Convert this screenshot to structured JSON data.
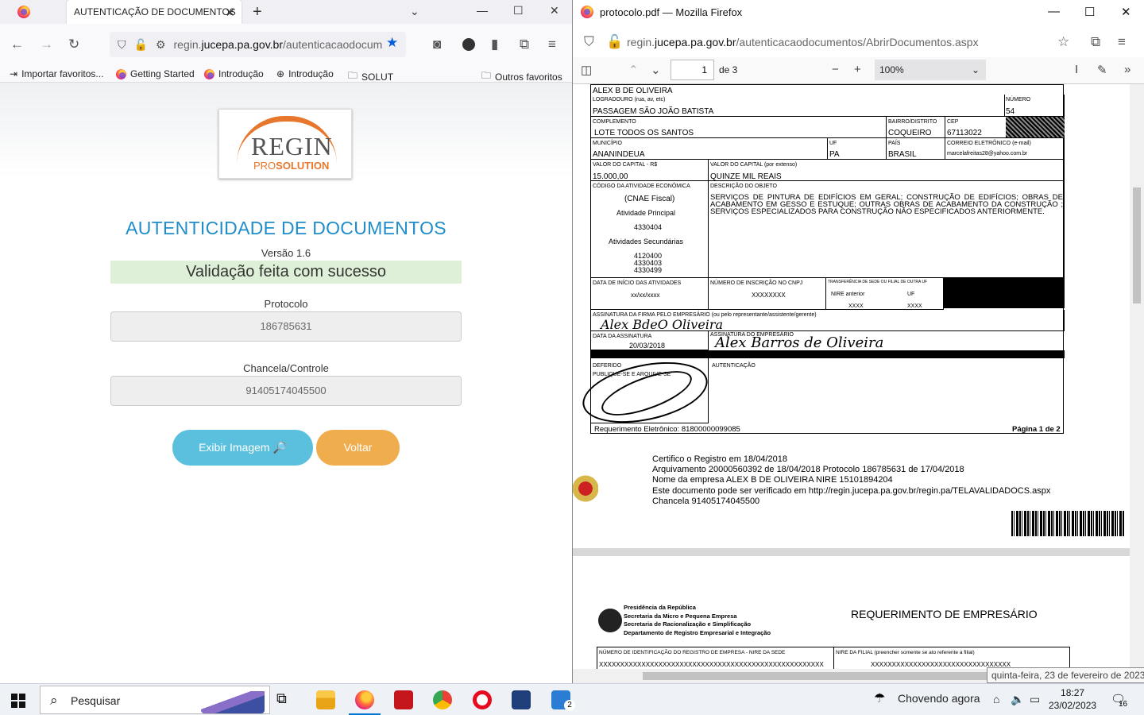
{
  "left": {
    "tab_title": "AUTENTICAÇÃO DE DOCUMENTOS",
    "tab_close": "✕",
    "new_tab": "+",
    "url_host": "regin.",
    "url_bold": "jucepa.pa.gov.br",
    "url_rest": "/autenticacaodocum",
    "bookmarks": [
      "Importar favoritos...",
      "Getting Started",
      "Introdução",
      "Introdução",
      "SOLUT",
      "Outros favoritos"
    ],
    "logo_word": "REGIN",
    "logo_pro": "PRO",
    "logo_solution": "SOLUTION",
    "page_title": "AUTENTICIDADE DE DOCUMENTOS",
    "version": "Versão 1.6",
    "success": "Validação feita com sucesso",
    "protocolo_label": "Protocolo",
    "protocolo_value": "186785631",
    "chancela_label": "Chancela/Controle",
    "chancela_value": "91405174045500",
    "btn_show": "Exibir Imagem 🔎",
    "btn_back": "Voltar"
  },
  "right": {
    "window_title": "protocolo.pdf — Mozilla Firefox",
    "url_host": "regin.",
    "url_bold": "jucepa.pa.gov.br",
    "url_rest": "/autenticacaodocumentos/AbrirDocumentos.aspx",
    "page_number": "1",
    "page_of": "de 3",
    "zoom": "100%",
    "form": {
      "name": "ALEX B DE OLIVEIRA",
      "logradouro_label": "LOGRADOURO (rua, av, etc)",
      "logradouro": "PASSAGEM SÃO JOÃO BATISTA",
      "numero_label": "NÚMERO",
      "numero": "54",
      "complemento_label": "COMPLEMENTO",
      "complemento": "LOTE TODOS OS SANTOS",
      "bairro_label": "BAIRRO/DISTRITO",
      "bairro": "COQUEIRO",
      "cep_label": "CEP",
      "cep": "67113022",
      "municipio_label": "MUNICÍPIO",
      "municipio": "ANANINDEUA",
      "uf_label": "UF",
      "uf": "PA",
      "pais_label": "PAÍS",
      "pais": "BRASIL",
      "email_label": "CORREIO ELETRÔNICO (e-mail)",
      "email": "marcelafreitas28@yahoo.com.br",
      "capital_label": "VALOR DO CAPITAL - R$",
      "capital": "15.000,00",
      "capital_ext_label": "VALOR DO CAPITAL (por extenso)",
      "capital_ext": "QUINZE  MIL  REAIS",
      "cnae_label": "CÓDIGO DA ATIVIDADE ECONÔMICA",
      "cnae": "(CNAE Fiscal)",
      "ativ_principal_label": "Atividade Principal",
      "ativ_principal": "4330404",
      "ativ_sec_label": "Atividades Secundárias",
      "ativ_sec": [
        "4120400",
        "4330403",
        "4330499"
      ],
      "objeto_label": "DESCRIÇÃO DO OBJETO",
      "objeto": "SERVIÇOS DE PINTURA DE EDIFÍCIOS EM GERAL; CONSTRUÇÃO DE EDIFÍCIOS; OBRAS DE ACABAMENTO EM GESSO E ESTUQUE; OUTRAS OBRAS DE ACABAMENTO DA CONSTRUÇÃO ; SERVIÇOS ESPECIALIZADOS PARA CONSTRUÇÃO NÃO ESPECIFICADOS ANTERIORMENTE.",
      "inicio_label": "DATA DE INÍCIO DAS ATIVIDADES",
      "inicio": "xx/xx/xxxx",
      "cnpj_label": "NÚMERO DE INSCRIÇÃO NO CNPJ",
      "cnpj": "XXXXXXXX",
      "transf_label": "TRANSFERÊNCIA DE SEDE OU FILIAL DE OUTRA UF",
      "nire_ant_label": "NIRE anterior",
      "uf2_label": "UF",
      "nire_ant": "XXXX",
      "uf2": "XXXX",
      "assin_firma_label": "ASSINATURA DA FIRMA PELO EMPRESÁRIO (ou pelo representante/assistente/gerente)",
      "sig1": "Alex BdeO Oliveira",
      "data_assin_label": "DATA DA ASSINATURA",
      "data_assin": "20/03/2018",
      "assin_emp_label": "ASSINATURA DO EMPRESÁRIO",
      "sig2": "Alex Barros de Oliveira",
      "deferido_label": "DEFERIDO",
      "publique_label": "PUBLIQUE-SE E ARQUIVE-SE",
      "autenticacao_label": "AUTENTICAÇÃO",
      "req_eletronico": "Requerimento Eletrônico: 81800000099085",
      "pagina": "Página 1 de 2"
    },
    "cert_lines": [
      "Certifico o Registro em 18/04/2018",
      "Arquivamento 20000560392 de 18/04/2018 Protocolo 186785631 de 17/04/2018",
      "Nome da empresa ALEX B DE OLIVEIRA NIRE 15101894204",
      "Este documento pode ser verificado em http://regin.jucepa.pa.gov.br/regin.pa/TELAVALIDADOCS.aspx",
      "Chancela 91405174045500"
    ],
    "gov_lines": [
      "Presidência da República",
      "Secretaria da Micro e Pequena Empresa",
      "Secretaria de Racionalização e Simplificação",
      "Departamento de Registro Empresarial e Integração"
    ],
    "req_title": "REQUERIMENTO DE EMPRESÁRIO",
    "nire_sede_label": "NÚMERO DE IDENTIFICAÇÃO DO REGISTRO DE EMPRESA - NIRE DA SEDE",
    "nire_filial_label": "NIRE DA FILIAL (preencher somente se ato referente a filial)",
    "nire_sede": "XXXXXXXXXXXXXXXXXXXXXXXXXXXXXXXXXXXXXXXXXXXXXXXXXXXXX",
    "nire_filial": "XXXXXXXXXXXXXXXXXXXXXXXXXXXXXXXXX",
    "tooltip": "quinta-feira, 23 de fevereiro de 2023"
  },
  "taskbar": {
    "search": "Pesquisar",
    "weather": "Chovendo agora",
    "time": "18:27",
    "date": "23/02/2023",
    "notif_count": "16",
    "mail_badge": "2"
  },
  "colors": {
    "title_blue": "#1f8dc9",
    "success_bg": "#dff0d8",
    "btn_info": "#5bc0de",
    "btn_warning": "#f0ad4e",
    "logo_orange": "#e8772e",
    "firefox_blue": "#0060df"
  }
}
